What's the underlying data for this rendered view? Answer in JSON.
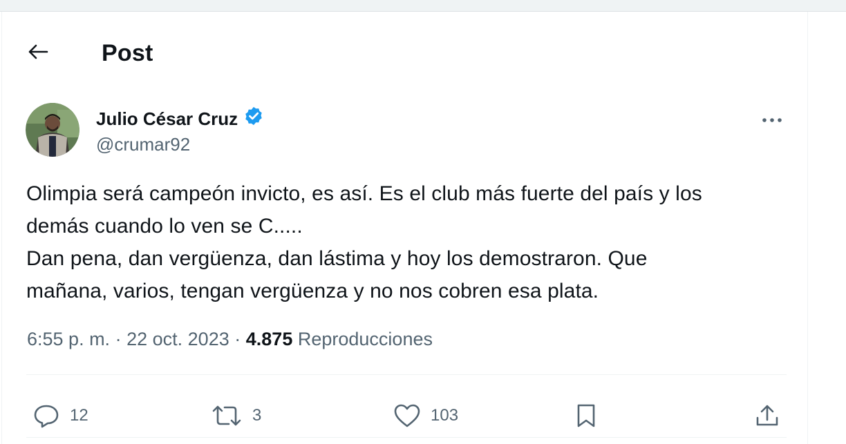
{
  "header": {
    "back_icon": "arrow-left-icon",
    "title": "Post"
  },
  "author": {
    "name": "Julio César Cruz",
    "handle": "@crumar92",
    "verified_icon": "verified-badge-icon",
    "verified_color": "#1d9bf0"
  },
  "post": {
    "text": "Olimpia será campeón invicto, es así. Es el club más fuerte del país y los\ndemás cuando lo ven se C.....\nDan pena, dan vergüenza, dan lástima y hoy los demostraron. Que\nmañana, varios, tengan vergüenza y no nos cobren esa plata.",
    "time": "6:55 p. m.",
    "separator": "·",
    "date": "22 oct. 2023",
    "views_count": "4.875",
    "views_label": "Reproducciones"
  },
  "actions": {
    "replies": "12",
    "reposts": "3",
    "likes": "103",
    "icons": [
      "reply-icon",
      "repost-icon",
      "like-icon",
      "bookmark-icon",
      "share-icon"
    ]
  },
  "colors": {
    "text_primary": "#0f1419",
    "text_secondary": "#536471",
    "accent": "#1d9bf0",
    "divider": "#eff3f4"
  }
}
